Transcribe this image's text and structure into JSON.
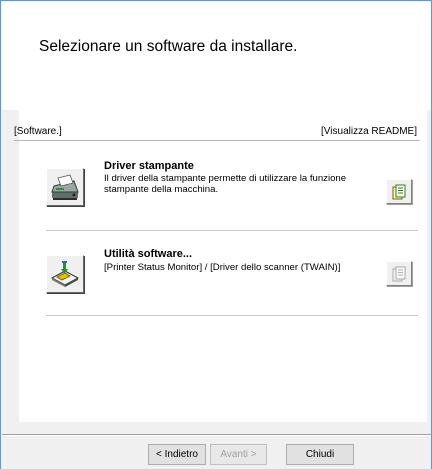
{
  "dialog": {
    "heading": "Selezionare un software da installare."
  },
  "list": {
    "software_header": "[Software.]",
    "readme_header": "[Visualizza README]",
    "items": [
      {
        "title": "Driver stampante",
        "description": "Il driver della stampante permette di utilizzare la funzione stampante della macchina.",
        "icon": "printer-driver-icon",
        "readme_enabled": true
      },
      {
        "title": "Utilità software...",
        "description": "[Printer Status Monitor] / [Driver dello scanner (TWAIN)]",
        "icon": "software-utility-icon",
        "readme_enabled": false
      }
    ]
  },
  "buttons": {
    "back": "< Indietro",
    "next": "Avanti >",
    "close": "Chiudi"
  },
  "colors": {
    "window_border": "#5b9bd5",
    "dialog_background": "#f0f0f0",
    "panel_background": "#ffffff"
  }
}
